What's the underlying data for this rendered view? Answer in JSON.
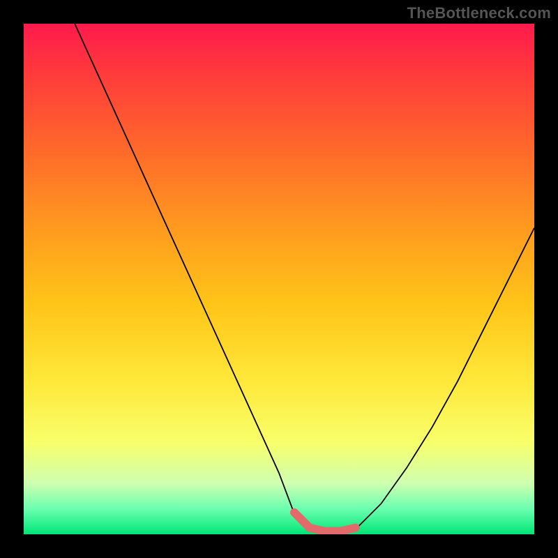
{
  "watermark": "TheBottleneck.com",
  "chart_data": {
    "type": "line",
    "title": "",
    "xlabel": "",
    "ylabel": "",
    "xlim": [
      0,
      100
    ],
    "ylim": [
      0,
      100
    ],
    "grid": false,
    "legend": false,
    "series": [
      {
        "name": "bottleneck-curve",
        "x": [
          10,
          15,
          20,
          25,
          30,
          35,
          40,
          45,
          50,
          53,
          56,
          59,
          62,
          65,
          70,
          75,
          80,
          85,
          90,
          95,
          100
        ],
        "values": [
          100,
          89,
          78,
          67,
          56,
          45,
          34,
          23,
          12,
          4,
          1,
          0,
          0,
          1,
          6,
          13,
          21,
          30,
          40,
          50,
          60
        ]
      }
    ],
    "annotations": [
      {
        "name": "optimal-trough-highlight",
        "type": "segment",
        "x_start": 52,
        "x_end": 66,
        "y": 0,
        "color": "#e26a6a"
      }
    ],
    "background_gradient": {
      "direction": "vertical",
      "stops": [
        {
          "pos": 0.0,
          "color": "#ff1a4d"
        },
        {
          "pos": 0.5,
          "color": "#ffc518"
        },
        {
          "pos": 1.0,
          "color": "#00e676"
        }
      ]
    }
  }
}
